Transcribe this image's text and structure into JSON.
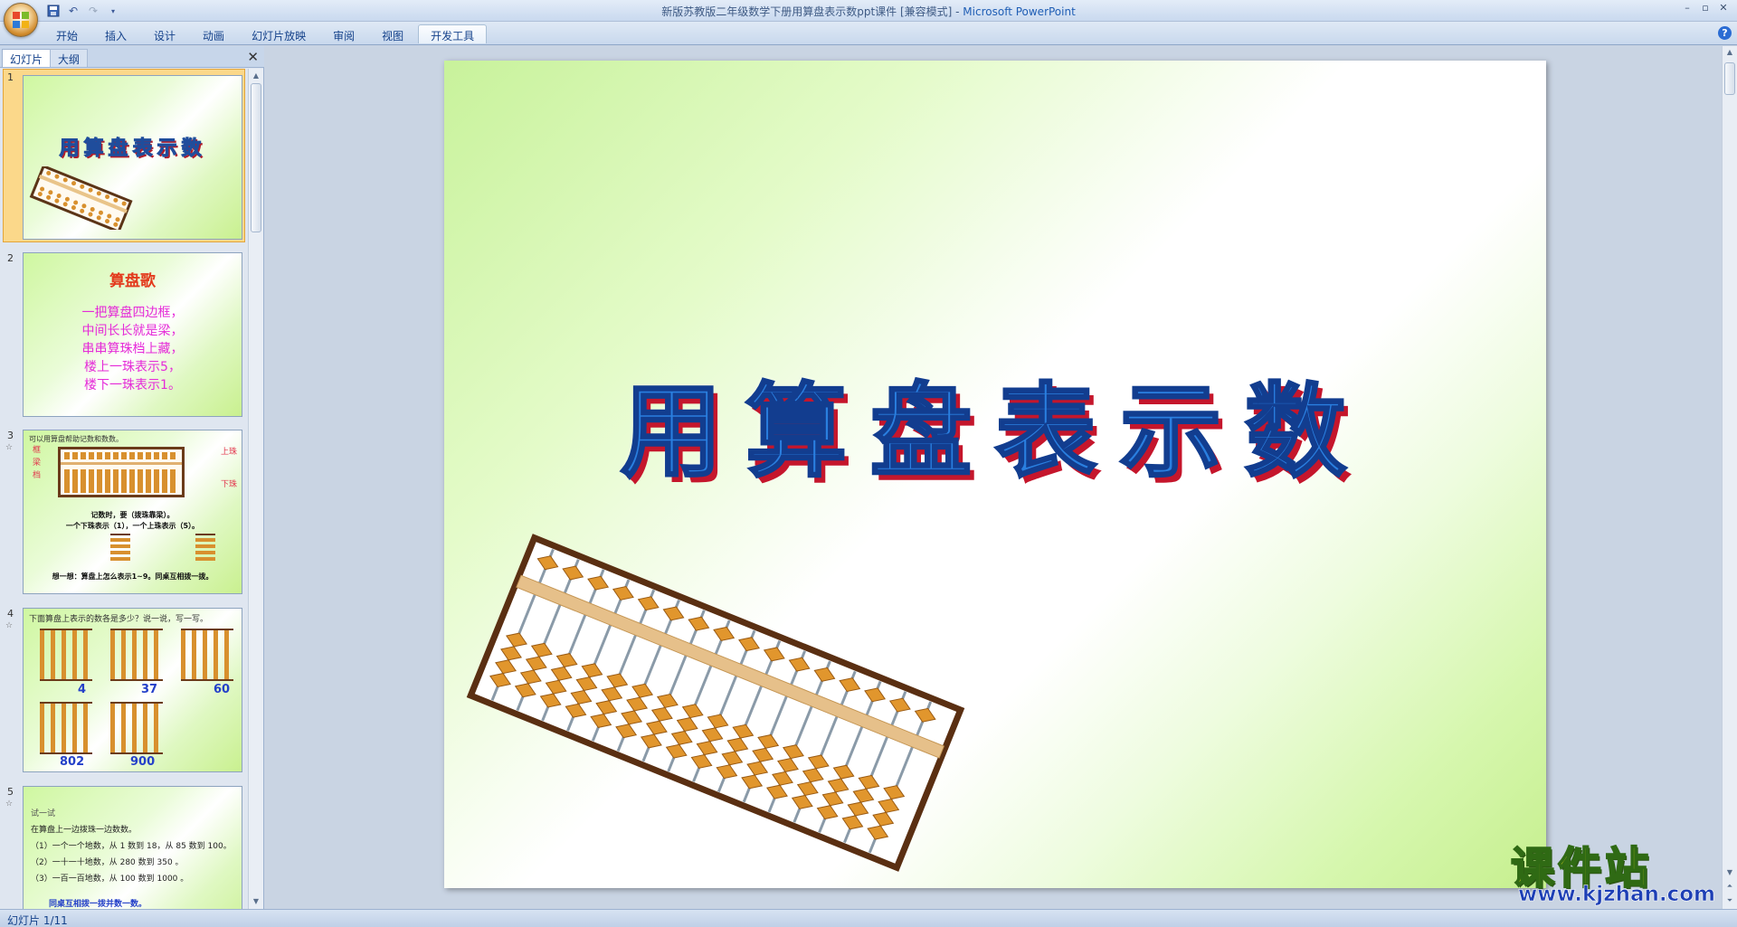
{
  "window": {
    "title": "新版苏教版二年级数学下册用算盘表示数ppt课件 [兼容模式]",
    "app_name": "Microsoft PowerPoint",
    "title_separator": " - "
  },
  "ribbon": {
    "tabs": [
      {
        "label": "开始",
        "active": false
      },
      {
        "label": "插入",
        "active": false
      },
      {
        "label": "设计",
        "active": false
      },
      {
        "label": "动画",
        "active": false
      },
      {
        "label": "幻灯片放映",
        "active": false
      },
      {
        "label": "审阅",
        "active": false
      },
      {
        "label": "视图",
        "active": false
      },
      {
        "label": "开发工具",
        "active": true
      }
    ]
  },
  "left_pane": {
    "tab_slides": "幻灯片",
    "tab_outline": "大纲",
    "thumbnails": [
      {
        "number": "1",
        "title": "用算盘表示数"
      },
      {
        "number": "2",
        "title": "算盘歌",
        "lines": [
          "一把算盘四边框，",
          "中间长长就是梁，",
          "串串算珠档上藏，",
          "楼上一珠表示5，",
          "楼下一珠表示1。"
        ]
      },
      {
        "number": "3",
        "heading": "可以用算盘帮助记数和数数。",
        "labels": {
          "frame": "框",
          "beam": "梁",
          "rod": "档",
          "upper": "上珠",
          "lower": "下珠"
        },
        "line1": "记数时，要（拨珠靠梁）。",
        "line2": "一个下珠表示（1），一个上珠表示（5）。",
        "line3": "想一想：算盘上怎么表示1~9。同桌互相拨一拨。"
      },
      {
        "number": "4",
        "heading": "下面算盘上表示的数各是多少？说一说，写一写。",
        "answers": [
          "4",
          "37",
          "60",
          "802",
          "900"
        ]
      },
      {
        "number": "5",
        "heading": "试一试",
        "lines": [
          "在算盘上一边拨珠一边数数。",
          "（1）一个一个地数，从 1 数到 18，从 85 数到 100。",
          "（2）一十一十地数，从 280 数到 350 。",
          "（3）一百一百地数，从 100 数到 1000 。"
        ],
        "footer": "同桌互相拨一拨并数一数。"
      }
    ]
  },
  "slide": {
    "title": "用算盘表示数"
  },
  "watermark": {
    "name": "课件站",
    "url": "www.kjzhan.com"
  },
  "status_bar": {
    "slide_info": "幻灯片 1/11"
  },
  "colors": {
    "ribbon": "#c8d8ed",
    "title_blue": "#2a7fe0",
    "title_shadow": "#c5162c",
    "slide_green": "#c8f29b"
  }
}
